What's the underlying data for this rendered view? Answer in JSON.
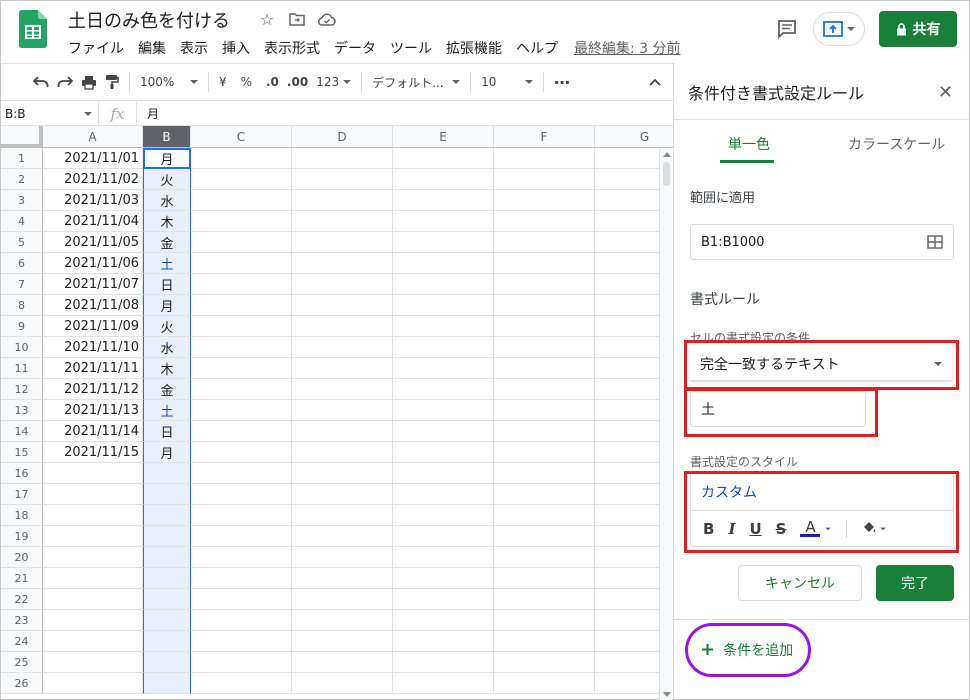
{
  "header": {
    "title": "土日のみ色を付ける",
    "menus": [
      "ファイル",
      "編集",
      "表示",
      "挿入",
      "表示形式",
      "データ",
      "ツール",
      "拡張機能",
      "ヘルプ"
    ],
    "last_edit": "最終編集: 3 分前",
    "share_label": "共有",
    "icons": [
      "star-icon",
      "move-folder-icon",
      "cloud-status-icon"
    ]
  },
  "toolbar": {
    "zoom": "100%",
    "currency": "¥",
    "percent": "%",
    "dec_decrease": ".0",
    "dec_increase": ".00",
    "number_format": "123",
    "font": "デフォルト...",
    "font_size": "10",
    "more": "⋯"
  },
  "formula_bar": {
    "name_box": "B:B",
    "fx": "fx",
    "value": "月"
  },
  "grid": {
    "columns": [
      "A",
      "B",
      "C",
      "D",
      "E",
      "F",
      "G"
    ],
    "rows": [
      {
        "n": "1",
        "a": "2021/11/01",
        "b": "月"
      },
      {
        "n": "2",
        "a": "2021/11/02",
        "b": "火"
      },
      {
        "n": "3",
        "a": "2021/11/03",
        "b": "水"
      },
      {
        "n": "4",
        "a": "2021/11/04",
        "b": "木"
      },
      {
        "n": "5",
        "a": "2021/11/05",
        "b": "金"
      },
      {
        "n": "6",
        "a": "2021/11/06",
        "b": "土"
      },
      {
        "n": "7",
        "a": "2021/11/07",
        "b": "日"
      },
      {
        "n": "8",
        "a": "2021/11/08",
        "b": "月"
      },
      {
        "n": "9",
        "a": "2021/11/09",
        "b": "火"
      },
      {
        "n": "10",
        "a": "2021/11/10",
        "b": "水"
      },
      {
        "n": "11",
        "a": "2021/11/11",
        "b": "木"
      },
      {
        "n": "12",
        "a": "2021/11/12",
        "b": "金"
      },
      {
        "n": "13",
        "a": "2021/11/13",
        "b": "土"
      },
      {
        "n": "14",
        "a": "2021/11/14",
        "b": "日"
      },
      {
        "n": "15",
        "a": "2021/11/15",
        "b": "月"
      },
      {
        "n": "16",
        "a": "",
        "b": ""
      },
      {
        "n": "17",
        "a": "",
        "b": ""
      },
      {
        "n": "18",
        "a": "",
        "b": ""
      },
      {
        "n": "19",
        "a": "",
        "b": ""
      },
      {
        "n": "20",
        "a": "",
        "b": ""
      },
      {
        "n": "21",
        "a": "",
        "b": ""
      },
      {
        "n": "22",
        "a": "",
        "b": ""
      },
      {
        "n": "23",
        "a": "",
        "b": ""
      },
      {
        "n": "24",
        "a": "",
        "b": ""
      },
      {
        "n": "25",
        "a": "",
        "b": ""
      },
      {
        "n": "26",
        "a": "",
        "b": ""
      }
    ],
    "highlight_value": "土",
    "highlight_color": "#1a48c8"
  },
  "panel": {
    "title": "条件付き書式設定ルール",
    "tab_single": "単一色",
    "tab_scale": "カラースケール",
    "range_label": "範囲に適用",
    "range_value": "B1:B1000",
    "rules_label": "書式ルール",
    "condition_label": "セルの書式設定の条件…",
    "condition_value": "完全一致するテキスト",
    "condition_input": "土",
    "style_label": "書式設定のスタイル",
    "style_name": "カスタム",
    "style_tools": {
      "bold": "B",
      "italic": "I",
      "underline": "U",
      "strike": "S",
      "text_color": "A"
    },
    "cancel_label": "キャンセル",
    "done_label": "完了",
    "add_condition_label": "条件を追加"
  },
  "colors": {
    "brand_green": "#188038",
    "selection_blue": "#1a73e8",
    "annotation_red": "#e01f1f",
    "annotation_purple": "#9a14e6"
  }
}
